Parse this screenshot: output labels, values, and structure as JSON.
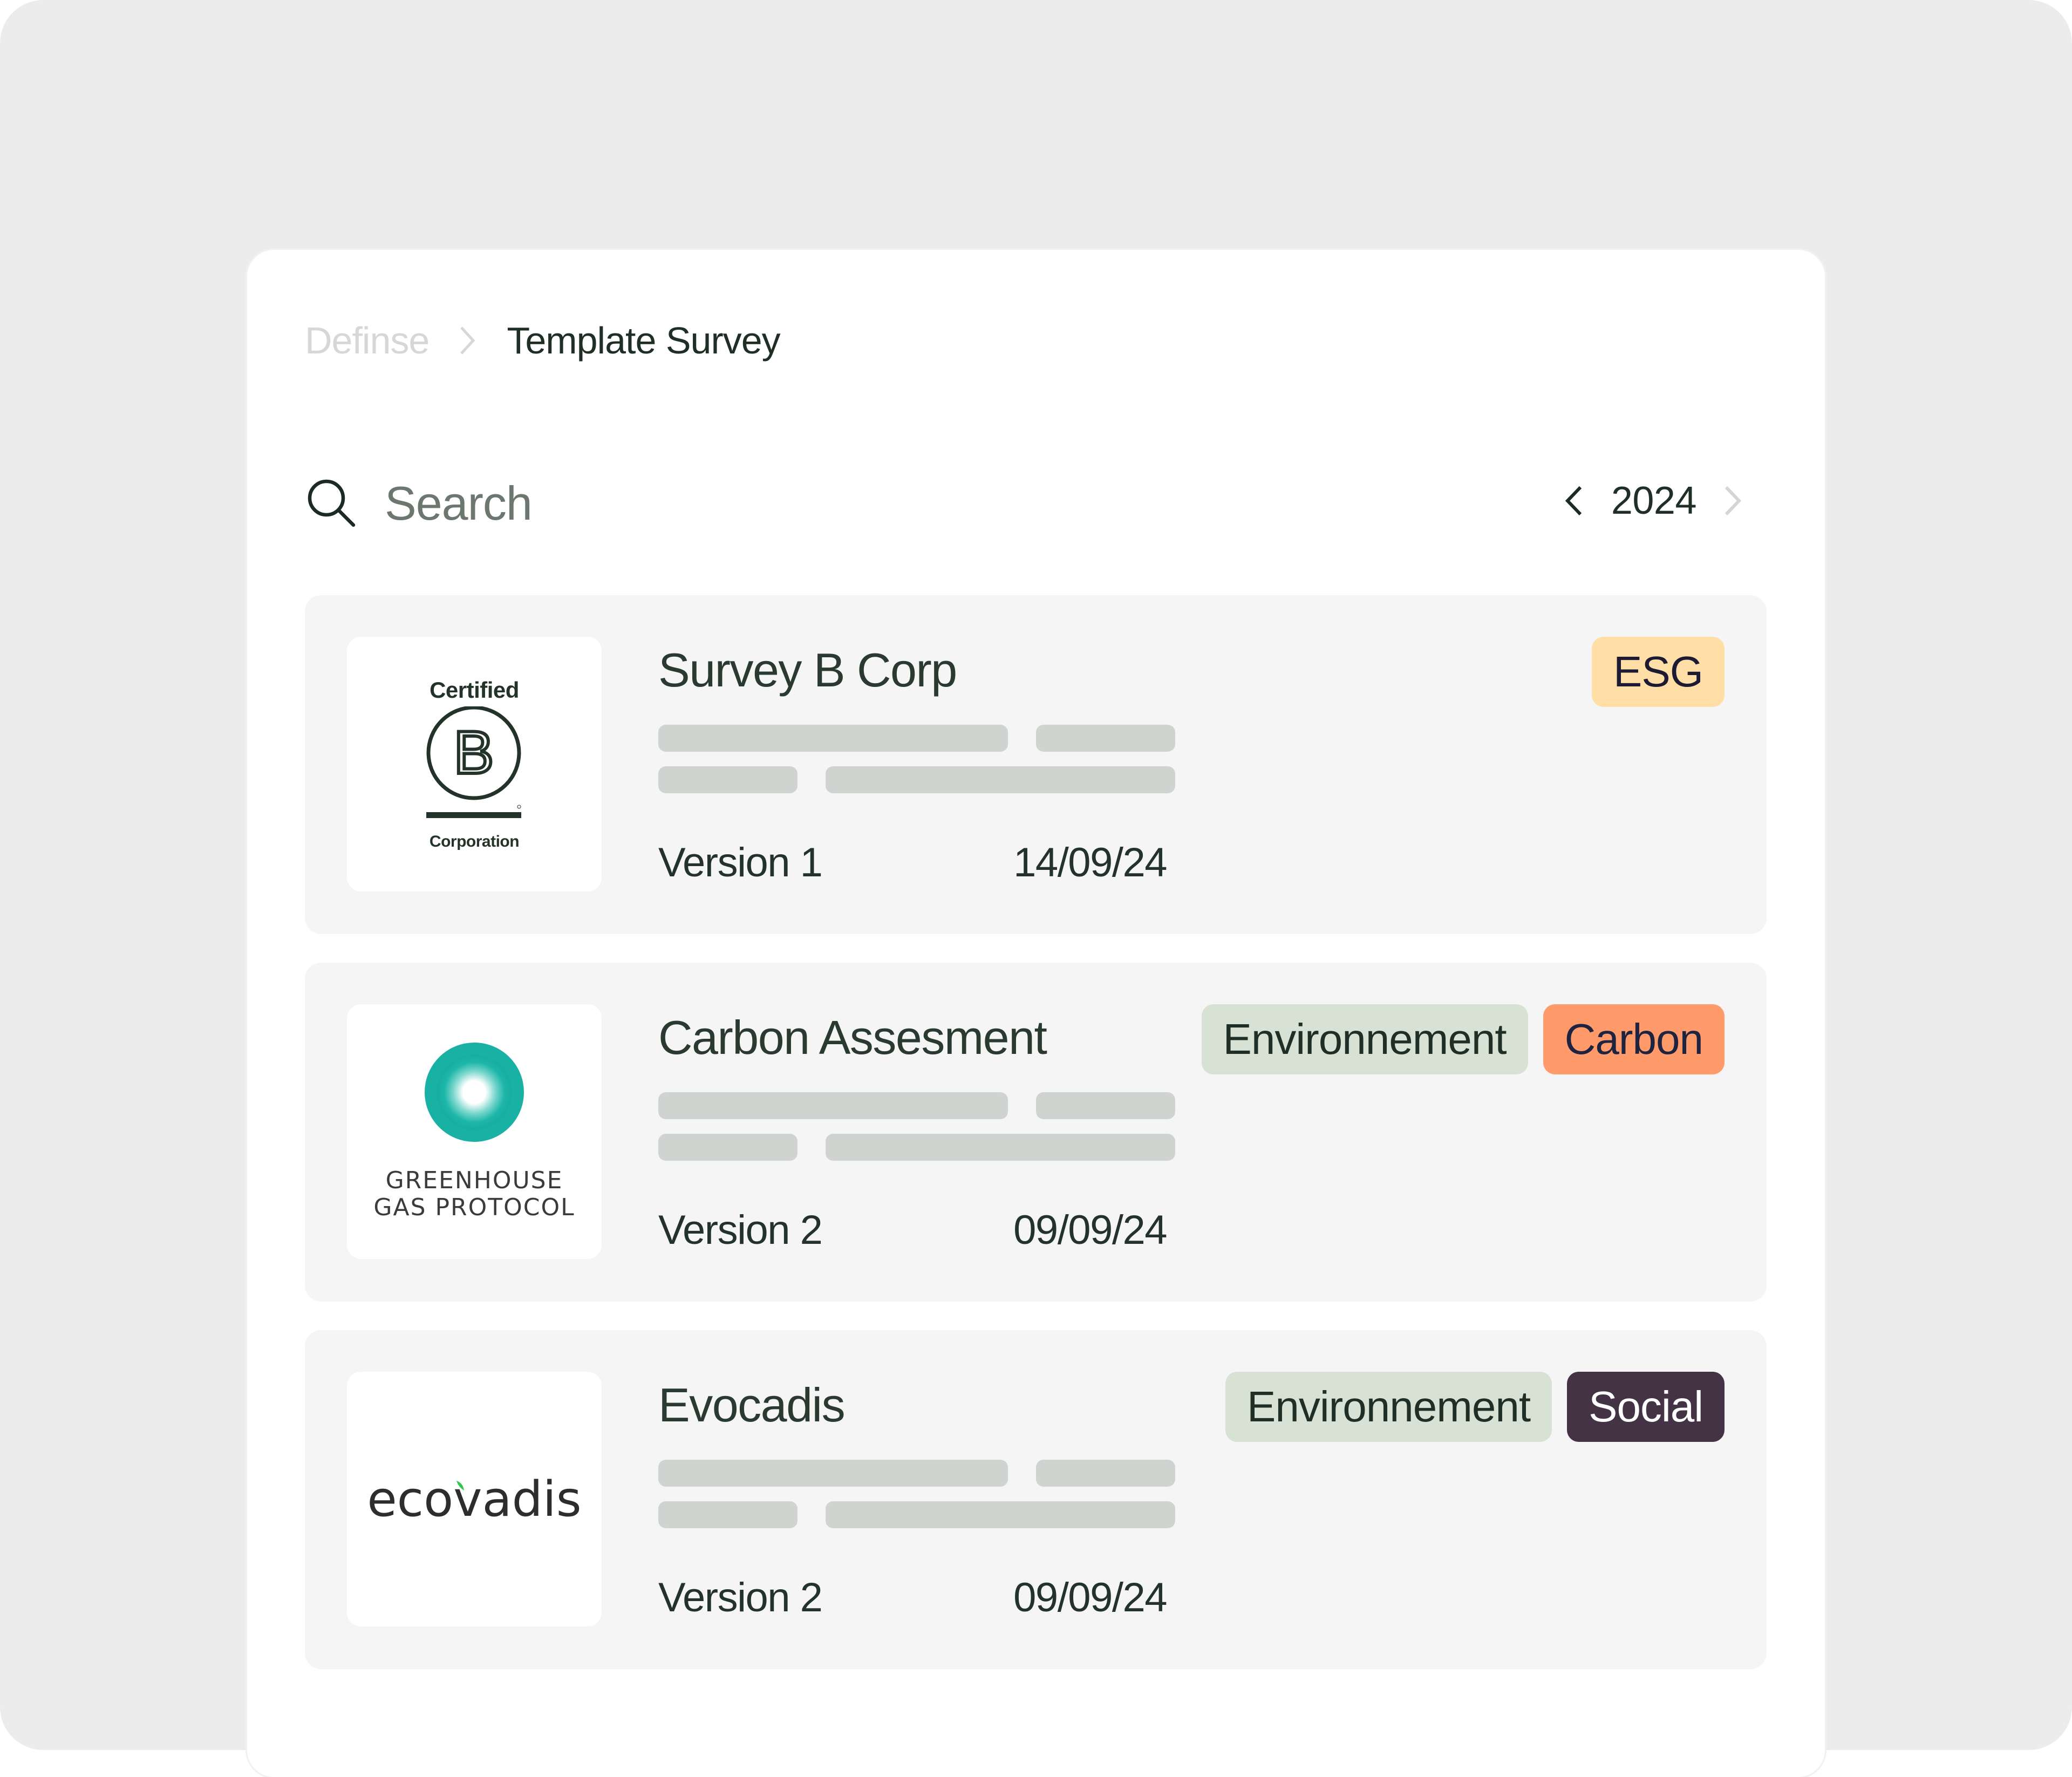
{
  "breadcrumb": {
    "root": "Definse",
    "separator_icon": "chevron-right-icon",
    "current": "Template Survey"
  },
  "search": {
    "icon": "search-icon",
    "placeholder": "Search",
    "value": ""
  },
  "year_nav": {
    "prev_icon": "chevron-left-icon",
    "year": "2024",
    "next_icon": "chevron-right-icon"
  },
  "surveys": [
    {
      "title": "Survey B Corp",
      "logo": {
        "name": "b-corp-logo",
        "top_text": "Certified",
        "letter": "B",
        "bottom_text": "Corporation"
      },
      "version": "Version 1",
      "date": "14/09/24",
      "tags": [
        {
          "label": "ESG",
          "bg": "#FFDFA6",
          "fg": "#1E1A33"
        }
      ]
    },
    {
      "title": "Carbon Assesment",
      "logo": {
        "name": "greenhouse-gas-protocol-logo",
        "line1": "GREENHOUSE",
        "line2": "GAS PROTOCOL",
        "color": "#1BB3A6"
      },
      "version": "Version 2",
      "date": "09/09/24",
      "tags": [
        {
          "label": "Environnement",
          "bg": "#D7E1D4",
          "fg": "#1F2F26"
        },
        {
          "label": "Carbon",
          "bg": "#FF9A6A",
          "fg": "#1E2340"
        }
      ]
    },
    {
      "title": "Evocadis",
      "logo": {
        "name": "ecovadis-logo",
        "text_before": "eco",
        "text_after": "adis",
        "leaf_color": "#2DC84D"
      },
      "version": "Version 2",
      "date": "09/09/24",
      "tags": [
        {
          "label": "Environnement",
          "bg": "#D7E1D4",
          "fg": "#1F2F26"
        },
        {
          "label": "Social",
          "bg": "#433344",
          "fg": "#FFFFFF"
        }
      ]
    }
  ],
  "colors": {
    "frame_bg": "#EBECEB",
    "panel_bg": "#FFFFFF",
    "card_bg": "#F5F5F5",
    "skeleton": "#D0D4D0",
    "text_primary": "#1F2F26",
    "text_muted": "#6C776F",
    "breadcrumb_muted": "#D5D8D5"
  }
}
